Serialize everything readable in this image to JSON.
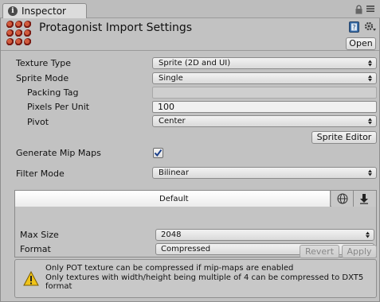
{
  "window": {
    "tab_label": "Inspector"
  },
  "header": {
    "title": "Protagonist Import Settings",
    "open_label": "Open"
  },
  "fields": {
    "texture_type": {
      "label": "Texture Type",
      "value": "Sprite (2D and UI)"
    },
    "sprite_mode": {
      "label": "Sprite Mode",
      "value": "Single"
    },
    "packing_tag": {
      "label": "Packing Tag",
      "value": ""
    },
    "pixels_per_unit": {
      "label": "Pixels Per Unit",
      "value": "100"
    },
    "pivot": {
      "label": "Pivot",
      "value": "Center"
    },
    "sprite_editor_label": "Sprite Editor",
    "generate_mip_maps": {
      "label": "Generate Mip Maps",
      "checked": true
    },
    "filter_mode": {
      "label": "Filter Mode",
      "value": "Bilinear"
    }
  },
  "platform": {
    "default_tab": "Default",
    "icons": [
      "globe-icon",
      "download-icon"
    ],
    "max_size": {
      "label": "Max Size",
      "value": "2048"
    },
    "format": {
      "label": "Format",
      "value": "Compressed"
    }
  },
  "actions": {
    "revert_label": "Revert",
    "apply_label": "Apply"
  },
  "help": {
    "line1": "Only POT texture can be compressed if mip-maps are enabled",
    "line2": "Only textures with width/height being multiple of 4 can be compressed to DXT5",
    "line3": "format"
  },
  "colors": {
    "panel_bg": "#c2c2c2",
    "warning_yellow": "#f0c419"
  }
}
